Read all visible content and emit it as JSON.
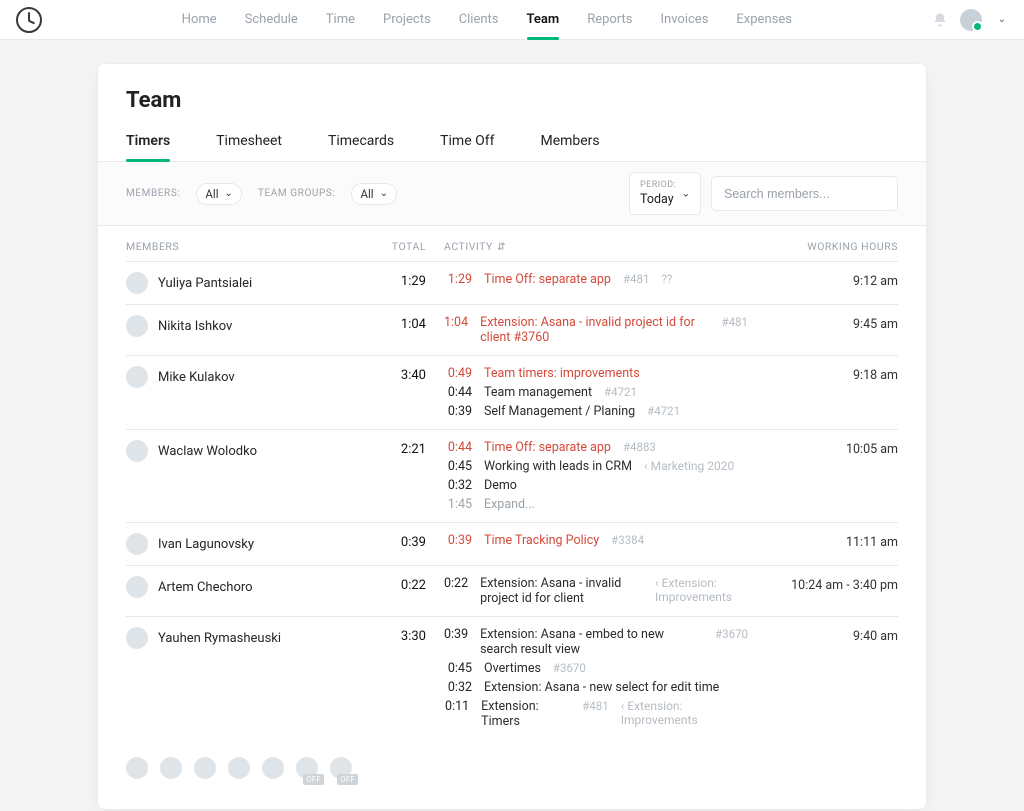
{
  "nav": {
    "items": [
      "Home",
      "Schedule",
      "Time",
      "Projects",
      "Clients",
      "Team",
      "Reports",
      "Invoices",
      "Expenses"
    ],
    "active": "Team"
  },
  "page": {
    "title": "Team",
    "tabs": [
      "Timers",
      "Timesheet",
      "Timecards",
      "Time Off",
      "Members"
    ],
    "activeTab": "Timers",
    "filters": {
      "membersLabel": "MEMBERS:",
      "membersValue": "All",
      "teamGroupsLabel": "TEAM GROUPS:",
      "teamGroupsValue": "All",
      "periodLabel": "PERIOD:",
      "periodValue": "Today",
      "searchPlaceholder": "Search members..."
    },
    "columns": {
      "members": "MEMBERS",
      "total": "TOTAL",
      "activity": "ACTIVITY",
      "hours": "WORKING HOURS"
    },
    "rows": [
      {
        "name": "Yuliya Pantsialei",
        "total": "1:29",
        "hours": "9:12 am",
        "activities": [
          {
            "time": "1:29",
            "title": "Time Off: separate app",
            "tag": "#481",
            "extra": "??",
            "active": true
          }
        ]
      },
      {
        "name": "Nikita Ishkov",
        "total": "1:04",
        "hours": "9:45 am",
        "activities": [
          {
            "time": "1:04",
            "title": "Extension: Asana - invalid project id for client #3760",
            "tag": "#481",
            "active": true
          }
        ]
      },
      {
        "name": "Mike Kulakov",
        "total": "3:40",
        "hours": "9:18 am",
        "activities": [
          {
            "time": "0:49",
            "title": "Team timers: improvements",
            "active": true
          },
          {
            "time": "0:44",
            "title": "Team management",
            "tag": "#4721"
          },
          {
            "time": "0:39",
            "title": "Self Management / Planing",
            "tag": "#4721"
          }
        ]
      },
      {
        "name": "Waclaw Wolodko",
        "total": "2:21",
        "hours": "10:05 am",
        "activities": [
          {
            "time": "0:44",
            "title": "Time Off: separate app",
            "tag": "#4883",
            "active": true
          },
          {
            "time": "0:45",
            "title": "Working with leads in CRM",
            "crumb": "Marketing 2020"
          },
          {
            "time": "0:32",
            "title": "Demo"
          },
          {
            "time": "1:45",
            "title": "Expand...",
            "expand": true
          }
        ]
      },
      {
        "name": "Ivan Lagunovsky",
        "total": "0:39",
        "hours": "11:11 am",
        "activities": [
          {
            "time": "0:39",
            "title": "Time Tracking Policy",
            "tag": "#3384",
            "active": true
          }
        ]
      },
      {
        "name": "Artem Chechoro",
        "total": "0:22",
        "hours": "10:24 am - 3:40 pm",
        "activities": [
          {
            "time": "0:22",
            "title": "Extension: Asana - invalid project id for client",
            "crumb": "Extension: Improvements"
          }
        ]
      },
      {
        "name": "Yauhen Rymasheuski",
        "total": "3:30",
        "hours": "9:40 am",
        "activities": [
          {
            "time": "0:39",
            "title": "Extension: Asana - embed to new search result view",
            "tag": "#3670"
          },
          {
            "time": "0:45",
            "title": "Overtimes",
            "tag": "#3670"
          },
          {
            "time": "0:32",
            "title": "Extension: Asana - new select for edit time"
          },
          {
            "time": "0:11",
            "title": "Extension: Timers",
            "tag": "#481",
            "crumb": "Extension: Improvements"
          }
        ]
      }
    ],
    "footerOffBadge": "OFF",
    "footerAvatars": [
      false,
      false,
      false,
      false,
      false,
      true,
      true
    ]
  }
}
